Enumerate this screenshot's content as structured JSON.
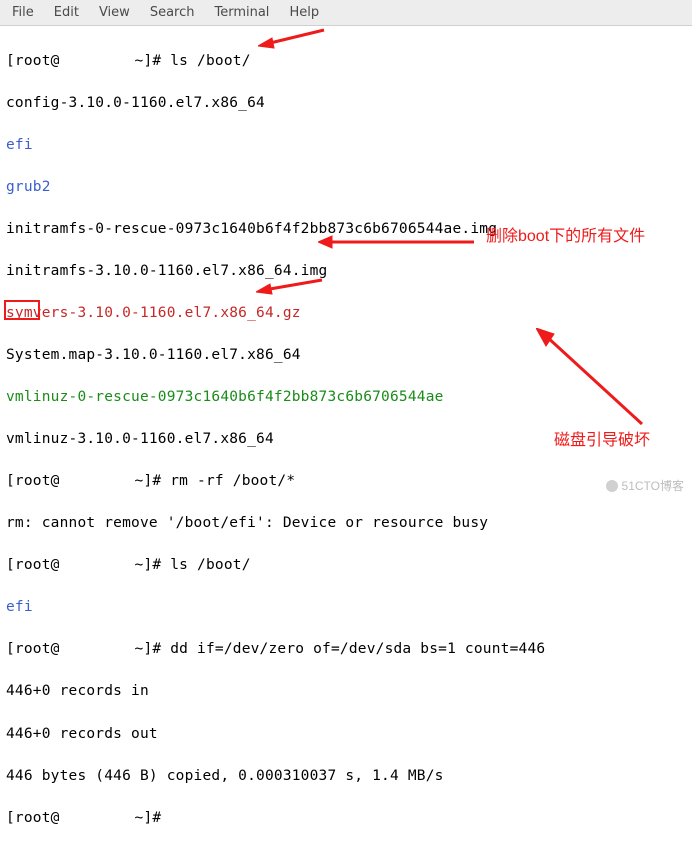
{
  "menubar": {
    "items": [
      "File",
      "Edit",
      "View",
      "Search",
      "Terminal",
      "Help"
    ]
  },
  "prompt": {
    "user_at": "[root@",
    "suffix": " ~]# "
  },
  "lines": {
    "cmd1": "ls /boot/",
    "out1": "config-3.10.0-1160.el7.x86_64",
    "out2": "efi",
    "out3": "grub2",
    "out4": "initramfs-0-rescue-0973c1640b6f4f2bb873c6b6706544ae.img",
    "out5": "initramfs-3.10.0-1160.el7.x86_64.img",
    "out6": "symvers-3.10.0-1160.el7.x86_64.gz",
    "out7": "System.map-3.10.0-1160.el7.x86_64",
    "out8": "vmlinuz-0-rescue-0973c1640b6f4f2bb873c6b6706544ae",
    "out9": "vmlinuz-3.10.0-1160.el7.x86_64",
    "cmd2": "rm -rf /boot/*",
    "out10": "rm: cannot remove '/boot/efi': Device or resource busy",
    "cmd3": "ls /boot/",
    "out11": "efi",
    "cmd4": "dd if=/dev/zero of=/dev/sda bs=1 count=446",
    "out12": "446+0 records in",
    "out13": "446+0 records out",
    "out14": "446 bytes (446 B) copied, 0.000310037 s, 1.4 MB/s",
    "cmd5": ""
  },
  "annotations": {
    "rm_boot": "删除boot下的所有文件",
    "disk_boot": "磁盘引导破坏"
  },
  "watermark": "51CTO博客"
}
